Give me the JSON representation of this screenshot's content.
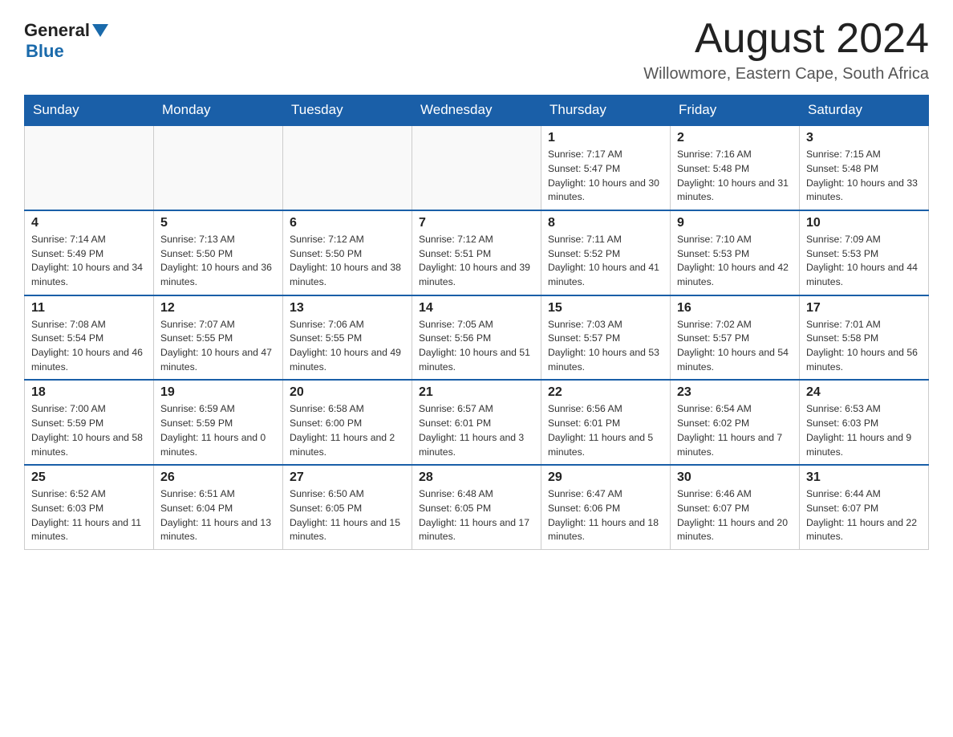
{
  "header": {
    "logo_general": "General",
    "logo_blue": "Blue",
    "month_title": "August 2024",
    "location": "Willowmore, Eastern Cape, South Africa"
  },
  "days_of_week": [
    "Sunday",
    "Monday",
    "Tuesday",
    "Wednesday",
    "Thursday",
    "Friday",
    "Saturday"
  ],
  "weeks": [
    [
      {
        "day": "",
        "info": ""
      },
      {
        "day": "",
        "info": ""
      },
      {
        "day": "",
        "info": ""
      },
      {
        "day": "",
        "info": ""
      },
      {
        "day": "1",
        "info": "Sunrise: 7:17 AM\nSunset: 5:47 PM\nDaylight: 10 hours and 30 minutes."
      },
      {
        "day": "2",
        "info": "Sunrise: 7:16 AM\nSunset: 5:48 PM\nDaylight: 10 hours and 31 minutes."
      },
      {
        "day": "3",
        "info": "Sunrise: 7:15 AM\nSunset: 5:48 PM\nDaylight: 10 hours and 33 minutes."
      }
    ],
    [
      {
        "day": "4",
        "info": "Sunrise: 7:14 AM\nSunset: 5:49 PM\nDaylight: 10 hours and 34 minutes."
      },
      {
        "day": "5",
        "info": "Sunrise: 7:13 AM\nSunset: 5:50 PM\nDaylight: 10 hours and 36 minutes."
      },
      {
        "day": "6",
        "info": "Sunrise: 7:12 AM\nSunset: 5:50 PM\nDaylight: 10 hours and 38 minutes."
      },
      {
        "day": "7",
        "info": "Sunrise: 7:12 AM\nSunset: 5:51 PM\nDaylight: 10 hours and 39 minutes."
      },
      {
        "day": "8",
        "info": "Sunrise: 7:11 AM\nSunset: 5:52 PM\nDaylight: 10 hours and 41 minutes."
      },
      {
        "day": "9",
        "info": "Sunrise: 7:10 AM\nSunset: 5:53 PM\nDaylight: 10 hours and 42 minutes."
      },
      {
        "day": "10",
        "info": "Sunrise: 7:09 AM\nSunset: 5:53 PM\nDaylight: 10 hours and 44 minutes."
      }
    ],
    [
      {
        "day": "11",
        "info": "Sunrise: 7:08 AM\nSunset: 5:54 PM\nDaylight: 10 hours and 46 minutes."
      },
      {
        "day": "12",
        "info": "Sunrise: 7:07 AM\nSunset: 5:55 PM\nDaylight: 10 hours and 47 minutes."
      },
      {
        "day": "13",
        "info": "Sunrise: 7:06 AM\nSunset: 5:55 PM\nDaylight: 10 hours and 49 minutes."
      },
      {
        "day": "14",
        "info": "Sunrise: 7:05 AM\nSunset: 5:56 PM\nDaylight: 10 hours and 51 minutes."
      },
      {
        "day": "15",
        "info": "Sunrise: 7:03 AM\nSunset: 5:57 PM\nDaylight: 10 hours and 53 minutes."
      },
      {
        "day": "16",
        "info": "Sunrise: 7:02 AM\nSunset: 5:57 PM\nDaylight: 10 hours and 54 minutes."
      },
      {
        "day": "17",
        "info": "Sunrise: 7:01 AM\nSunset: 5:58 PM\nDaylight: 10 hours and 56 minutes."
      }
    ],
    [
      {
        "day": "18",
        "info": "Sunrise: 7:00 AM\nSunset: 5:59 PM\nDaylight: 10 hours and 58 minutes."
      },
      {
        "day": "19",
        "info": "Sunrise: 6:59 AM\nSunset: 5:59 PM\nDaylight: 11 hours and 0 minutes."
      },
      {
        "day": "20",
        "info": "Sunrise: 6:58 AM\nSunset: 6:00 PM\nDaylight: 11 hours and 2 minutes."
      },
      {
        "day": "21",
        "info": "Sunrise: 6:57 AM\nSunset: 6:01 PM\nDaylight: 11 hours and 3 minutes."
      },
      {
        "day": "22",
        "info": "Sunrise: 6:56 AM\nSunset: 6:01 PM\nDaylight: 11 hours and 5 minutes."
      },
      {
        "day": "23",
        "info": "Sunrise: 6:54 AM\nSunset: 6:02 PM\nDaylight: 11 hours and 7 minutes."
      },
      {
        "day": "24",
        "info": "Sunrise: 6:53 AM\nSunset: 6:03 PM\nDaylight: 11 hours and 9 minutes."
      }
    ],
    [
      {
        "day": "25",
        "info": "Sunrise: 6:52 AM\nSunset: 6:03 PM\nDaylight: 11 hours and 11 minutes."
      },
      {
        "day": "26",
        "info": "Sunrise: 6:51 AM\nSunset: 6:04 PM\nDaylight: 11 hours and 13 minutes."
      },
      {
        "day": "27",
        "info": "Sunrise: 6:50 AM\nSunset: 6:05 PM\nDaylight: 11 hours and 15 minutes."
      },
      {
        "day": "28",
        "info": "Sunrise: 6:48 AM\nSunset: 6:05 PM\nDaylight: 11 hours and 17 minutes."
      },
      {
        "day": "29",
        "info": "Sunrise: 6:47 AM\nSunset: 6:06 PM\nDaylight: 11 hours and 18 minutes."
      },
      {
        "day": "30",
        "info": "Sunrise: 6:46 AM\nSunset: 6:07 PM\nDaylight: 11 hours and 20 minutes."
      },
      {
        "day": "31",
        "info": "Sunrise: 6:44 AM\nSunset: 6:07 PM\nDaylight: 11 hours and 22 minutes."
      }
    ]
  ]
}
